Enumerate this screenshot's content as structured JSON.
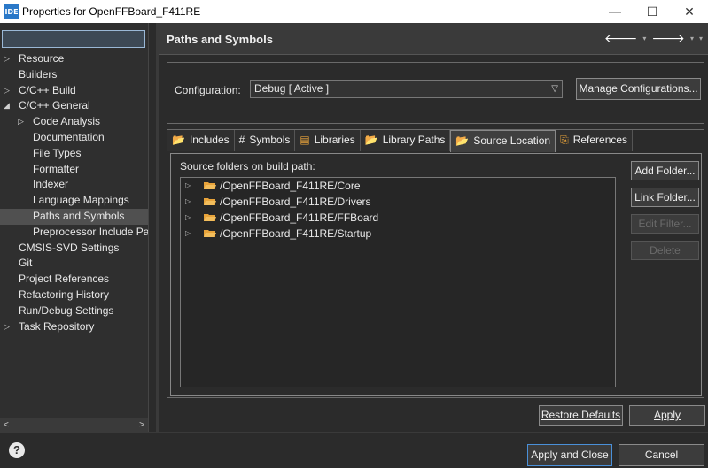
{
  "window": {
    "icon_label": "IDE",
    "title": "Properties for OpenFFBoard_F411RE",
    "minimize": "—",
    "maximize": "☐",
    "close": "✕"
  },
  "sidebar": {
    "filter_value": "",
    "items": [
      {
        "label": "Resource",
        "level": 0,
        "twisty": "▷"
      },
      {
        "label": "Builders",
        "level": 0,
        "twisty": ""
      },
      {
        "label": "C/C++ Build",
        "level": 0,
        "twisty": "▷"
      },
      {
        "label": "C/C++ General",
        "level": 0,
        "twisty": "◢"
      },
      {
        "label": "Code Analysis",
        "level": 1,
        "twisty": "▷"
      },
      {
        "label": "Documentation",
        "level": 1,
        "twisty": ""
      },
      {
        "label": "File Types",
        "level": 1,
        "twisty": ""
      },
      {
        "label": "Formatter",
        "level": 1,
        "twisty": ""
      },
      {
        "label": "Indexer",
        "level": 1,
        "twisty": ""
      },
      {
        "label": "Language Mappings",
        "level": 1,
        "twisty": ""
      },
      {
        "label": "Paths and Symbols",
        "level": 1,
        "twisty": "",
        "selected": true
      },
      {
        "label": "Preprocessor Include Pat",
        "level": 1,
        "twisty": ""
      },
      {
        "label": "CMSIS-SVD Settings",
        "level": 0,
        "twisty": ""
      },
      {
        "label": "Git",
        "level": 0,
        "twisty": ""
      },
      {
        "label": "Project References",
        "level": 0,
        "twisty": ""
      },
      {
        "label": "Refactoring History",
        "level": 0,
        "twisty": ""
      },
      {
        "label": "Run/Debug Settings",
        "level": 0,
        "twisty": ""
      },
      {
        "label": "Task Repository",
        "level": 0,
        "twisty": "▷"
      }
    ],
    "scroll_left": "<",
    "scroll_right": ">"
  },
  "header": {
    "title": "Paths and Symbols",
    "back": "🡐",
    "forward": "🡒",
    "menu": "▾"
  },
  "config": {
    "label": "Configuration:",
    "value": "Debug  [ Active ]",
    "manage_button": "Manage Configurations..."
  },
  "tabs": [
    {
      "label": "Includes",
      "icon": "📂",
      "active": false
    },
    {
      "label": "Symbols",
      "icon": "#",
      "active": false
    },
    {
      "label": "Libraries",
      "icon": "▤",
      "active": false
    },
    {
      "label": "Library Paths",
      "icon": "📂",
      "active": false
    },
    {
      "label": "Source Location",
      "icon": "📂",
      "active": true
    },
    {
      "label": "References",
      "icon": "⎘",
      "active": false
    }
  ],
  "source": {
    "label": "Source folders on build path:",
    "folders": [
      "/OpenFFBoard_F411RE/Core",
      "/OpenFFBoard_F411RE/Drivers",
      "/OpenFFBoard_F411RE/FFBoard",
      "/OpenFFBoard_F411RE/Startup"
    ],
    "add_folder": "Add Folder...",
    "link_folder": "Link Folder...",
    "edit_filter": "Edit Filter...",
    "delete": "Delete"
  },
  "footer": {
    "restore_defaults": "Restore Defaults",
    "apply": "Apply",
    "apply_and_close": "Apply and Close",
    "cancel": "Cancel",
    "help": "?"
  },
  "colors": {
    "folder": "#e8a33a",
    "selection": "#505050",
    "accent_border": "#4a90d9"
  }
}
